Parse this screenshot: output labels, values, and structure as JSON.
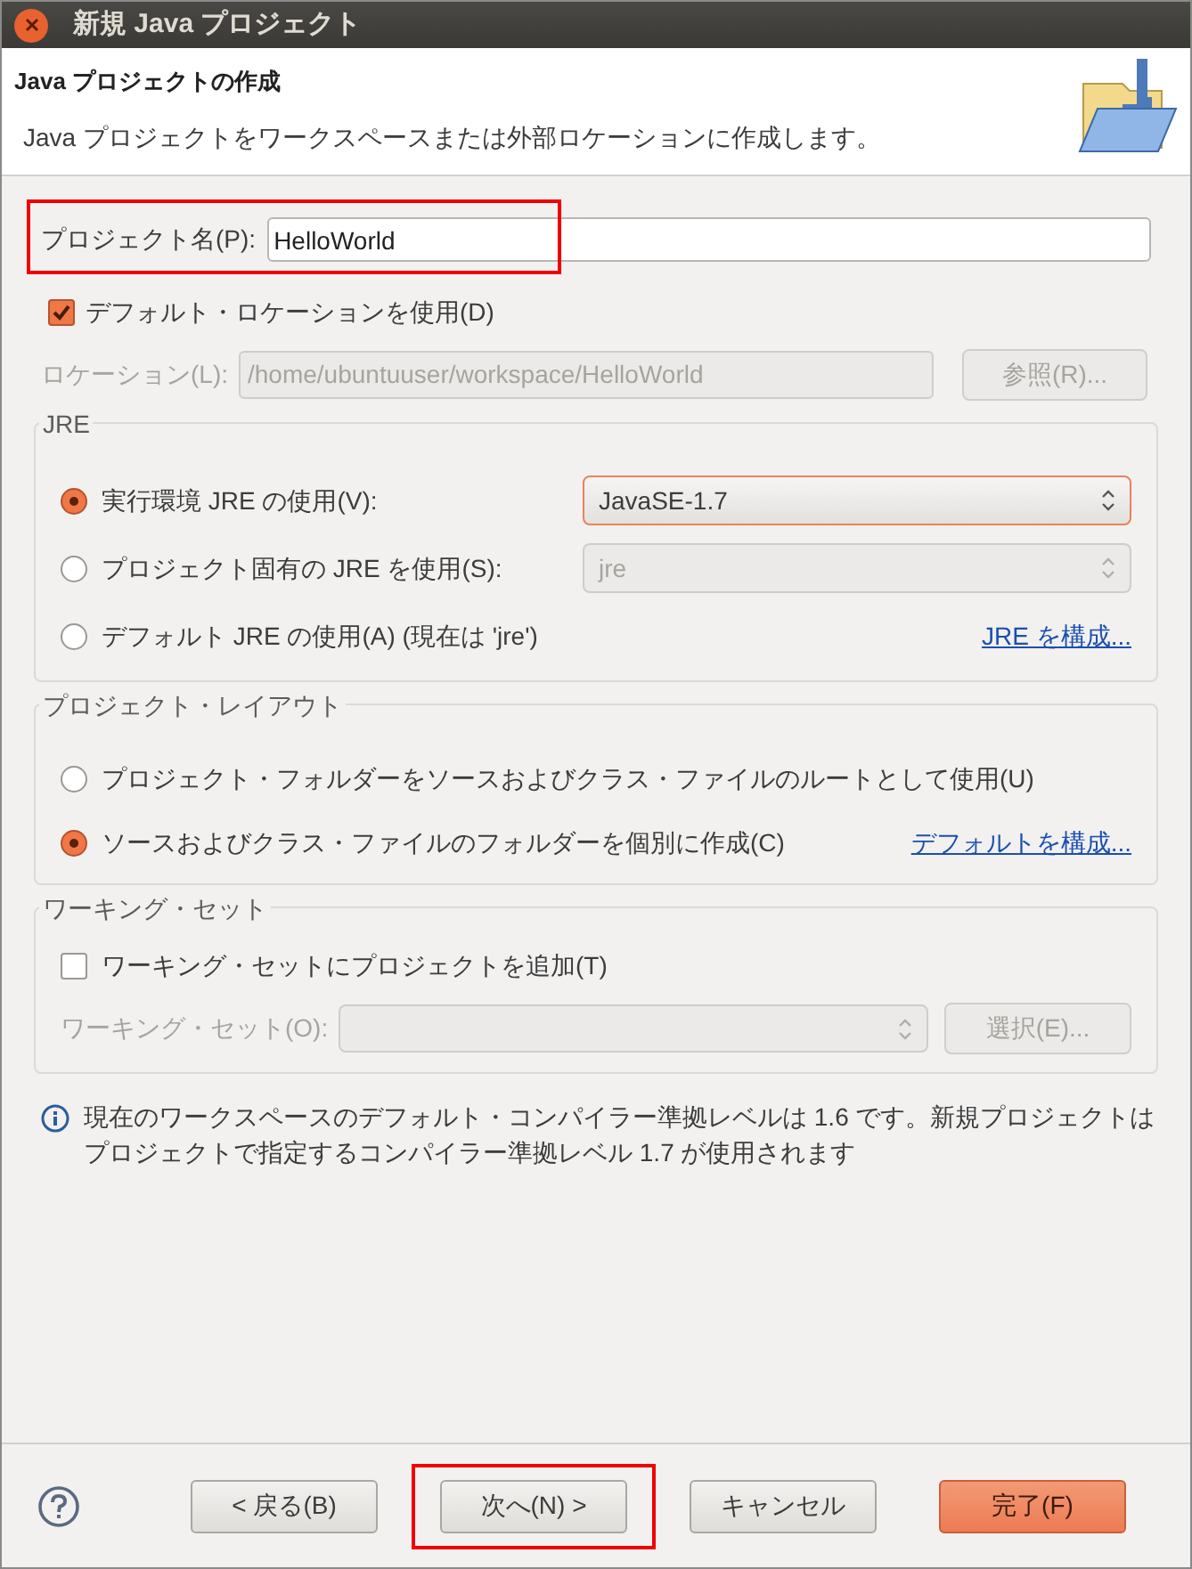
{
  "window": {
    "title": "新規 Java プロジェクト"
  },
  "header": {
    "title": "Java プロジェクトの作成",
    "description": "Java プロジェクトをワークスペースまたは外部ロケーションに作成します。"
  },
  "project_name": {
    "label": "プロジェクト名(P):",
    "value": "HelloWorld",
    "highlighted": true
  },
  "default_location": {
    "label": "デフォルト・ロケーションを使用(D)",
    "checked": true
  },
  "location": {
    "label": "ロケーション(L):",
    "value": "/home/ubuntuuser/workspace/HelloWorld",
    "disabled": true,
    "button": "参照(R)..."
  },
  "jre": {
    "title": "JRE",
    "options": [
      {
        "label": "実行環境 JRE の使用(V):",
        "selected": true,
        "control": {
          "kind": "select",
          "value": "JavaSE-1.7",
          "disabled": false
        }
      },
      {
        "label": "プロジェクト固有の JRE を使用(S):",
        "selected": false,
        "control": {
          "kind": "select",
          "value": "jre",
          "disabled": true
        }
      },
      {
        "label": "デフォルト JRE の使用(A) (現在は 'jre')",
        "selected": false,
        "control": {
          "kind": "link",
          "label": "JRE を構成..."
        }
      }
    ]
  },
  "layout": {
    "title": "プロジェクト・レイアウト",
    "options": [
      {
        "label": "プロジェクト・フォルダーをソースおよびクラス・ファイルのルートとして使用(U)",
        "selected": false
      },
      {
        "label": "ソースおよびクラス・ファイルのフォルダーを個別に作成(C)",
        "selected": true,
        "control": {
          "kind": "link",
          "label": "デフォルトを構成..."
        }
      }
    ]
  },
  "working_set": {
    "title": "ワーキング・セット",
    "add": {
      "label": "ワーキング・セットにプロジェクトを追加(T)",
      "checked": false
    },
    "field_label": "ワーキング・セット(O):",
    "disabled": true,
    "button": "選択(E)..."
  },
  "info": "現在のワークスペースのデフォルト・コンパイラー準拠レベルは 1.6 です。新規プロジェクトはプロジェクトで指定するコンパイラー準拠レベル 1.7 が使用されます",
  "buttons": [
    {
      "label": "< 戻る(B)",
      "kind": "normal",
      "highlighted": false
    },
    {
      "label": "次へ(N) >",
      "kind": "normal",
      "highlighted": true
    },
    {
      "label": "キャンセル",
      "kind": "normal",
      "highlighted": false
    },
    {
      "label": "完了(F)",
      "kind": "default",
      "highlighted": false
    }
  ]
}
